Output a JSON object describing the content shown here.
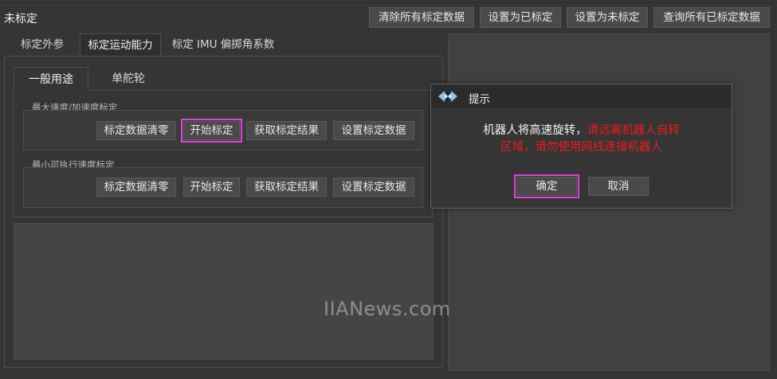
{
  "header": {
    "status": "未标定",
    "buttons": {
      "clear_all": "清除所有标定数据",
      "set_calibrated": "设置为已标定",
      "set_uncalibrated": "设置为未标定",
      "query_all": "查询所有已标定数据"
    }
  },
  "tabs": [
    {
      "label": "标定外参"
    },
    {
      "label": "标定运动能力"
    },
    {
      "label": "标定 IMU 偏掷角系数"
    }
  ],
  "subtabs": [
    {
      "label": "一般用途"
    },
    {
      "label": "单舵轮"
    }
  ],
  "groups": [
    {
      "label": "最大速度/加速度标定",
      "buttons": {
        "clear": "标定数据清零",
        "start": "开始标定",
        "get": "获取标定结果",
        "set": "设置标定数据"
      }
    },
    {
      "label": "最小可执行速度标定",
      "buttons": {
        "clear": "标定数据清零",
        "start": "开始标定",
        "get": "获取标定结果",
        "set": "设置标定数据"
      }
    }
  ],
  "watermark": "IIANews.com",
  "dialog": {
    "title": "提示",
    "message_white": "机器人将高速旋转，",
    "message_red_1": "请远离机器人自转",
    "message_red_2": "区域，请勿使用网线连接机器人",
    "ok": "确定",
    "cancel": "取消"
  },
  "colors": {
    "highlight": "#e040e0",
    "warning_text": "#ee1b1b",
    "background": "#353535"
  }
}
